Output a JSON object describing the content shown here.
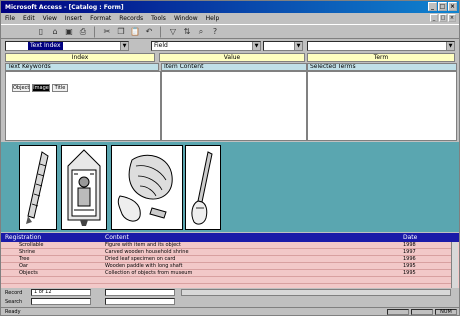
{
  "window": {
    "title": "Microsoft Access - [Catalog : Form]",
    "controls": [
      "_",
      "□",
      "×"
    ],
    "mdi_controls": [
      "_",
      "□",
      "×"
    ]
  },
  "menu": [
    "File",
    "Edit",
    "View",
    "Insert",
    "Format",
    "Records",
    "Tools",
    "Window",
    "Help"
  ],
  "toolbar": {
    "icons": [
      "new-icon",
      "open-icon",
      "save-icon",
      "print-icon",
      "cut-icon",
      "copy-icon",
      "paste-icon",
      "undo-icon",
      "filter-icon",
      "sort-icon",
      "find-icon",
      "help-icon"
    ],
    "glyphs": [
      "▯",
      "⌂",
      "▣",
      "⎙",
      "✂",
      "❐",
      "📋",
      "↶",
      "▽",
      "⇅",
      "⌕",
      "?"
    ]
  },
  "combos": {
    "first": "Text Index",
    "second": "Field",
    "third": "",
    "fourth": ""
  },
  "columns": {
    "col1_title": "Index",
    "col2_title": "Value",
    "col3_title": "Term",
    "col1_header": "Text Keywords",
    "col2_header": "Item Content",
    "col3_header": "Selected Terms"
  },
  "chips": [
    "Object",
    "Image",
    "Title"
  ],
  "grid": {
    "headers": [
      "Registration",
      "Content",
      "Date"
    ],
    "rows": [
      {
        "c1": "Scrollable",
        "c2": "Figure with item and its object",
        "c3": "1998"
      },
      {
        "c1": "Shrine",
        "c2": "Carved wooden household shrine",
        "c3": "1997"
      },
      {
        "c1": "Tree",
        "c2": "Dried leaf specimen on card",
        "c3": "1996"
      },
      {
        "c1": "Oar",
        "c2": "Wooden paddle with long shaft",
        "c3": "1995"
      },
      {
        "c1": "Objects",
        "c2": "Collection of objects from museum",
        "c3": "1995"
      },
      {
        "c1": "",
        "c2": "",
        "c3": ""
      }
    ]
  },
  "footer": {
    "label1": "Record",
    "value1": "1 of 12",
    "label2": "Search",
    "value2": "",
    "box3": "",
    "box4": ""
  },
  "status": {
    "text": "Ready",
    "cells": [
      "",
      "",
      "NUM"
    ]
  }
}
